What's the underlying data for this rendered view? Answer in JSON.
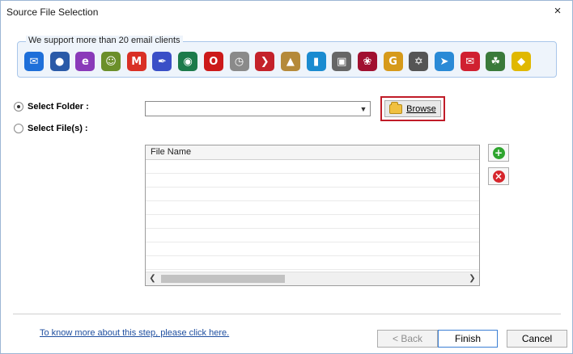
{
  "window": {
    "title": "Source File Selection",
    "close_glyph": "×"
  },
  "support": {
    "label": "We support more than 20 email clients",
    "clients": [
      {
        "icon": "mail-app-icon",
        "glyph": "✉",
        "color": "#1e6fd9"
      },
      {
        "icon": "thunderbird-icon",
        "glyph": "●",
        "color": "#2a5aa8"
      },
      {
        "icon": "email-client-e-icon",
        "glyph": "e",
        "color": "#8a3ab9"
      },
      {
        "icon": "people-icon",
        "glyph": "☺",
        "color": "#6b8f2a"
      },
      {
        "icon": "gmail-icon",
        "glyph": "M",
        "color": "#d93025"
      },
      {
        "icon": "feather-icon",
        "glyph": "✒",
        "color": "#3a4fc7"
      },
      {
        "icon": "globe-mail-icon",
        "glyph": "◉",
        "color": "#1c7a4a"
      },
      {
        "icon": "opera-icon",
        "glyph": "O",
        "color": "#cc1a1a"
      },
      {
        "icon": "clock-mail-icon",
        "glyph": "◷",
        "color": "#8a8a8a"
      },
      {
        "icon": "arrow-circle-icon",
        "glyph": "❯",
        "color": "#c4222a"
      },
      {
        "icon": "landscape-icon",
        "glyph": "▲",
        "color": "#b58a3a"
      },
      {
        "icon": "phone-icon",
        "glyph": "▮",
        "color": "#1a8bd0"
      },
      {
        "icon": "camera-icon",
        "glyph": "▣",
        "color": "#666666"
      },
      {
        "icon": "berry-icon",
        "glyph": "❀",
        "color": "#a01030"
      },
      {
        "icon": "g-badge-icon",
        "glyph": "G",
        "color": "#d69a1a"
      },
      {
        "icon": "gnu-icon",
        "glyph": "✡",
        "color": "#555555"
      },
      {
        "icon": "paper-plane-icon",
        "glyph": "➤",
        "color": "#2a8ad6"
      },
      {
        "icon": "envelope-red-icon",
        "glyph": "✉",
        "color": "#d02030"
      },
      {
        "icon": "seamonkey-icon",
        "glyph": "☘",
        "color": "#3a7a3a"
      },
      {
        "icon": "bat-icon",
        "glyph": "◆",
        "color": "#e0b800"
      }
    ]
  },
  "source": {
    "select_folder_label": "Select Folder :",
    "select_files_label": "Select File(s) :",
    "folder_value": "",
    "browse_label": "Browse"
  },
  "file_list": {
    "column_header": "File Name",
    "rows": [
      "",
      "",
      "",
      "",
      "",
      "",
      "",
      ""
    ]
  },
  "footer": {
    "help_link": "To know more about this step, please click here.",
    "back_label": "< Back",
    "finish_label": "Finish",
    "cancel_label": "Cancel"
  }
}
